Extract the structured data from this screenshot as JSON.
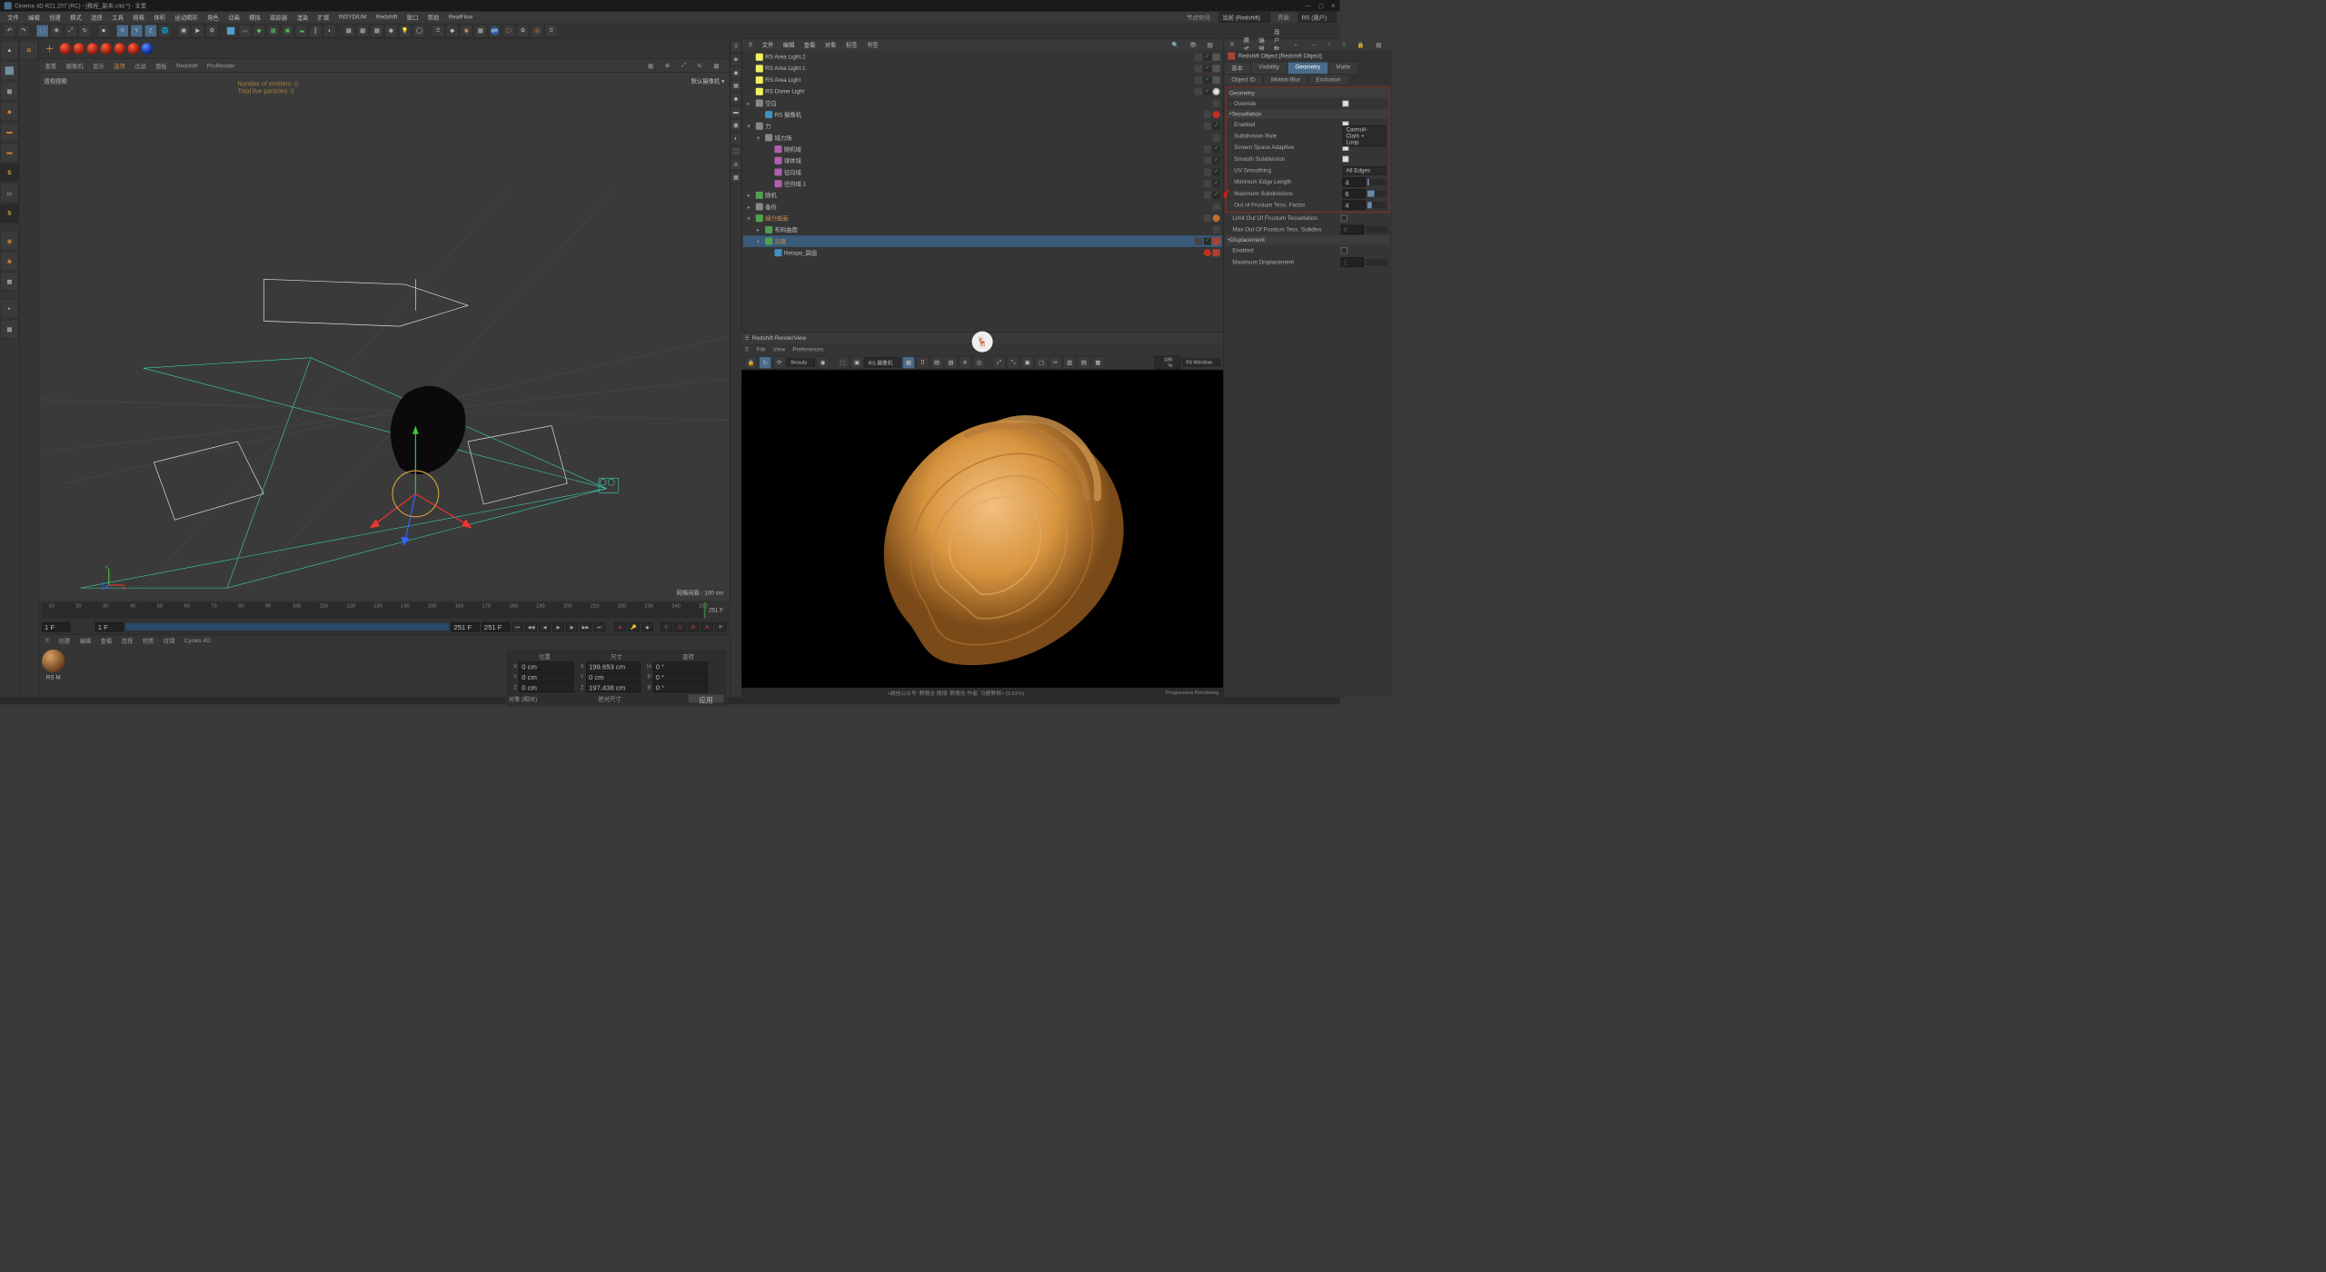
{
  "title": "Cinema 4D R21.207 (RC) - [教程_副本.c4d *] - 主要",
  "menus": [
    "文件",
    "编辑",
    "创建",
    "模式",
    "选择",
    "工具",
    "网格",
    "体积",
    "运动图形",
    "角色",
    "动画",
    "模拟",
    "跟踪器",
    "渲染",
    "扩展",
    "INSYDIUM",
    "Redshift",
    "窗口",
    "帮助",
    "RealFlow"
  ],
  "menu_right": {
    "node_space_lbl": "节点空间:",
    "node_space_val": "当前 (Redshift)",
    "iface_lbl": "界面:",
    "iface_val": "RS (用户)"
  },
  "vp_menu": [
    "查看",
    "摄像机",
    "显示",
    "选项",
    "过滤",
    "面板",
    "Redshift",
    "ProRender"
  ],
  "vp_menu_sel": "选项",
  "vp_tl": "透视视图",
  "vp_tr": "默认摄像机",
  "vp_stats": {
    "l1": "Number of emitters: 0",
    "l2": "Total live particles: 0"
  },
  "vp_br": "网格间距 : 100 cm",
  "timeline": {
    "start": "1 F",
    "end": "251 F",
    "cur": "251 F",
    "cur2": "251 F",
    "start2": "1 F",
    "marks": [
      10,
      20,
      30,
      40,
      50,
      60,
      70,
      80,
      90,
      100,
      110,
      120,
      130,
      140,
      150,
      160,
      170,
      180,
      190,
      200,
      210,
      220,
      230,
      240,
      250
    ]
  },
  "mat_tabs": [
    "创建",
    "编辑",
    "查看",
    "选择",
    "材质",
    "纹理",
    "Cycles 4D"
  ],
  "mat_name": "RS M",
  "coords": {
    "hdrs": [
      "位置",
      "尺寸",
      "旋转"
    ],
    "rows": [
      [
        "X",
        "0 cm",
        "X",
        "199.653 cm",
        "H",
        "0 °"
      ],
      [
        "Y",
        "0 cm",
        "Y",
        "0 cm",
        "P",
        "0 °"
      ],
      [
        "Z",
        "0 cm",
        "Z",
        "197.438 cm",
        "B",
        "0 °"
      ]
    ],
    "mode1": "对象 (相对)",
    "mode2": "绝对尺寸",
    "apply": "应用"
  },
  "obj_menu": [
    "文件",
    "编辑",
    "查看",
    "对象",
    "标签",
    "书签"
  ],
  "obj_tree": [
    {
      "icon": "#f0f060",
      "name": "RS Area Light.2",
      "depth": 0,
      "tags": [
        "vis",
        "chk",
        "rs"
      ]
    },
    {
      "icon": "#f0f060",
      "name": "RS Area Light.1",
      "depth": 0,
      "tags": [
        "vis",
        "chk",
        "rs"
      ]
    },
    {
      "icon": "#f0f060",
      "name": "RS Area Light",
      "depth": 0,
      "tags": [
        "vis",
        "chk",
        "rs"
      ]
    },
    {
      "icon": "#f0f060",
      "name": "RS Dome Light",
      "depth": 0,
      "tags": [
        "vis",
        "chk",
        "sky"
      ]
    },
    {
      "icon": "#888",
      "name": "空白",
      "depth": 0,
      "tags": [
        "vis"
      ],
      "exp": "+"
    },
    {
      "icon": "#4090c0",
      "name": "RS 摄像机",
      "depth": 1,
      "tags": [
        "vis",
        "red"
      ]
    },
    {
      "icon": "#888",
      "name": "力",
      "depth": 0,
      "tags": [
        "vis",
        "chk"
      ],
      "exp": "-"
    },
    {
      "icon": "#888",
      "name": "域力场",
      "depth": 1,
      "tags": [
        "vis"
      ],
      "exp": "-"
    },
    {
      "icon": "#b060b0",
      "name": "随机域",
      "depth": 2,
      "tags": [
        "vis",
        "chk"
      ]
    },
    {
      "icon": "#b060b0",
      "name": "球体域",
      "depth": 2,
      "tags": [
        "vis",
        "chk"
      ]
    },
    {
      "icon": "#b060b0",
      "name": "径向域",
      "depth": 2,
      "tags": [
        "vis",
        "chk"
      ]
    },
    {
      "icon": "#b060b0",
      "name": "径向域.1",
      "depth": 2,
      "tags": [
        "vis",
        "chk"
      ]
    },
    {
      "icon": "#50a050",
      "name": "随机",
      "depth": 0,
      "tags": [
        "vis",
        "chk"
      ],
      "exp": "+"
    },
    {
      "icon": "#888",
      "name": "备份",
      "depth": 0,
      "tags": [
        "vis"
      ],
      "exp": "+"
    },
    {
      "icon": "#50a050",
      "name": "细分曲面",
      "depth": 0,
      "tags": [
        "vis",
        "orange"
      ],
      "exp": "-",
      "namecolor": "#c88b4a"
    },
    {
      "icon": "#50a050",
      "name": "布料曲面",
      "depth": 1,
      "tags": [
        "vis"
      ],
      "exp": "+"
    },
    {
      "icon": "#50a050",
      "name": "克隆",
      "depth": 1,
      "tags": [
        "vis",
        "chk",
        "ex"
      ],
      "exp": "-",
      "namecolor": "#c88b4a",
      "sel": true
    },
    {
      "icon": "#4090c0",
      "name": "Retopo_圆盘",
      "depth": 2,
      "tags": [
        "red",
        "ex"
      ]
    }
  ],
  "rv_title": "Redshift RenderView",
  "rv_menu": [
    "File",
    "View",
    "Preferences"
  ],
  "rv_aov": "Beauty",
  "rv_cam": "RS 摄像机",
  "rv_pct": "185 %",
  "rv_fit": "Fit Window",
  "rv_status_l": "<微信公众号: 野鹿志  微博: 野鹿志  作者: 马鹿野郎>  (0.61%)",
  "rv_status_r": "Progressive Rendering",
  "attr_menu": [
    "模式",
    "编辑",
    "用户数据"
  ],
  "attr_title": "Redshift Object [Redshift Object]",
  "attr_tabs": [
    "基本",
    "Visibility",
    "Geometry",
    "Matte",
    "Object ID",
    "Motion Blur",
    "Exclusion"
  ],
  "attr_tab_sel": "Geometry",
  "geom": {
    "title": "Geometry",
    "override": "Override",
    "tess": "•Tessellation",
    "enabled": "Enabled",
    "subdiv_rule": "Subdivision Rule",
    "subdiv_val": "Catmull-Clark + Loop",
    "ssa": "Screen Space Adaptive",
    "smooth": "Smooth Subdivision",
    "uvs": "UV Smoothing",
    "uvs_val": "All Edges",
    "minedge": "Minimum Edge Length",
    "minedge_v": "4",
    "maxsub": "Maximum Subdivisions",
    "maxsub_v": "6",
    "outfrust": "Out of Frustum Tess. Factor",
    "outfrust_v": "4",
    "limit": "Limit Out Of Frustum Tessellation",
    "maxout": "Max Out Of Frustum Tess. Subdivs",
    "maxout_v": "6",
    "disp": "•Displacement",
    "disp_en": "Enabled",
    "maxdisp": "Maximum Displacement",
    "maxdisp_v": "1"
  }
}
